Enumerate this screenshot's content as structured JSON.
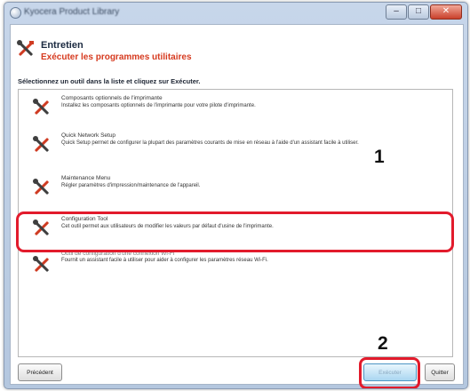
{
  "window": {
    "title": "Kyocera Product Library",
    "minimize_glyph": "–",
    "maximize_glyph": "□",
    "close_glyph": "✕"
  },
  "header": {
    "title": "Entretien",
    "subtitle": "Exécuter les programmes utilitaires",
    "icon": "tools-icon"
  },
  "instruction": "Sélectionnez un outil dans la liste et cliquez sur Exécuter.",
  "tools": [
    {
      "name": "Composants optionnels de l'imprimante",
      "description": "Installez les composants optionnels de l'imprimante pour votre pilote d'imprimante."
    },
    {
      "name": "Quick Network Setup",
      "description": "Quick Setup permet de configurer la plupart des paramètres courants de mise en réseau à l'aide d'un assistant facile à utiliser."
    },
    {
      "name": "Maintenance Menu",
      "description": "Régler paramètres d'impression/maintenance de l'appareil."
    },
    {
      "name": "Configuration Tool",
      "description": "Cet outil permet aux utilisateurs de modifier les valeurs par défaut d'usine de l'imprimante."
    },
    {
      "name": "Outil de configuration d'une connexion Wi-Fi",
      "description": "Fournit un assistant facile à utiliser pour aider à configurer les paramètres réseau Wi-Fi."
    }
  ],
  "callouts": {
    "step1": "1",
    "step2": "2"
  },
  "buttons": {
    "previous": "Précédent",
    "execute": "Exécuter",
    "quit": "Quitter"
  },
  "colors": {
    "accent_red": "#d63a1f",
    "highlight_red": "#e21b2c",
    "frame_blue": "#b4c7df"
  }
}
